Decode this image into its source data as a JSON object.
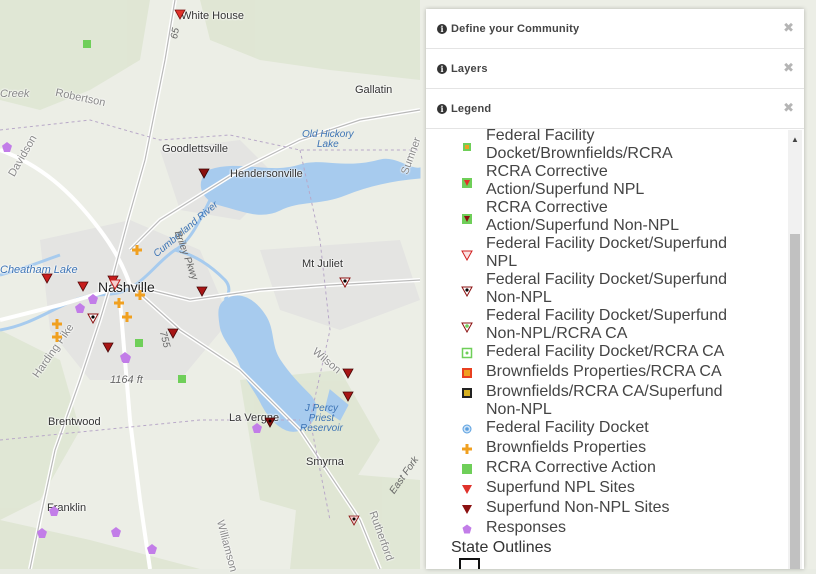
{
  "map": {
    "places": [
      {
        "id": "white-house",
        "label": "White House",
        "big": false
      },
      {
        "id": "gallatin",
        "label": "Gallatin",
        "big": false
      },
      {
        "id": "robertson",
        "label": "Robertson",
        "big": false
      },
      {
        "id": "creek",
        "label": "Creek",
        "big": false
      },
      {
        "id": "davidson",
        "label": "Davidson",
        "big": false
      },
      {
        "id": "goodlettsville",
        "label": "Goodlettsville",
        "big": false
      },
      {
        "id": "hendersonville",
        "label": "Hendersonville",
        "big": false
      },
      {
        "id": "mt-juliet",
        "label": "Mt Juliet",
        "big": false
      },
      {
        "id": "nashville",
        "label": "Nashville",
        "big": true
      },
      {
        "id": "brentwood",
        "label": "Brentwood",
        "big": false
      },
      {
        "id": "la-vergne",
        "label": "La Vergne",
        "big": false
      },
      {
        "id": "smyrna",
        "label": "Smyrna",
        "big": false
      },
      {
        "id": "franklin",
        "label": "Franklin",
        "big": false
      },
      {
        "id": "sumner",
        "label": "Sumner",
        "big": false
      },
      {
        "id": "wilson",
        "label": "Wilson",
        "big": false
      },
      {
        "id": "williamson",
        "label": "Williamson",
        "big": false
      },
      {
        "id": "rutherford",
        "label": "Rutherford",
        "big": false
      },
      {
        "id": "cheatham",
        "label": "Cheatham Lake",
        "big": false
      },
      {
        "id": "harding-pike",
        "label": "Harding Pike",
        "big": false
      },
      {
        "id": "elev",
        "label": "1164 ft",
        "big": false
      }
    ],
    "water_labels": [
      {
        "id": "old-hickory",
        "label": "Old Hickory\nLake"
      },
      {
        "id": "cumberland",
        "label": "Cumberland River"
      },
      {
        "id": "percy-priest",
        "label": "J Percy\nPriest\nReservoir"
      },
      {
        "id": "briley",
        "label": "Briley Pkwy"
      }
    ],
    "roads": [
      {
        "id": "east-fork",
        "label": "East Fork"
      },
      {
        "id": "rd-65",
        "label": "65"
      },
      {
        "id": "rd-755",
        "label": "755"
      }
    ],
    "markers": [
      {
        "type": "superfund-npl"
      },
      {
        "type": "superfund-npl"
      },
      {
        "type": "superfund-npl"
      },
      {
        "type": "superfund-npl"
      },
      {
        "type": "superfund-npl"
      },
      {
        "type": "superfund-npl"
      },
      {
        "type": "superfund-npl"
      },
      {
        "type": "superfund-npl"
      },
      {
        "type": "superfund-npl"
      },
      {
        "type": "superfund-npl"
      },
      {
        "type": "superfund-non-npl"
      },
      {
        "type": "superfund-non-npl"
      },
      {
        "type": "ffd-superfund-non-npl"
      },
      {
        "type": "ffd-superfund-non-npl"
      },
      {
        "type": "ffd-superfund-npl"
      },
      {
        "type": "brownfields"
      },
      {
        "type": "brownfields"
      },
      {
        "type": "brownfields"
      },
      {
        "type": "brownfields"
      },
      {
        "type": "brownfields"
      },
      {
        "type": "rcra-corrective"
      },
      {
        "type": "rcra-corrective"
      },
      {
        "type": "rcra-corrective"
      },
      {
        "type": "response"
      },
      {
        "type": "response"
      },
      {
        "type": "response"
      },
      {
        "type": "response"
      },
      {
        "type": "response"
      },
      {
        "type": "response"
      },
      {
        "type": "response"
      },
      {
        "type": "response"
      },
      {
        "type": "response"
      },
      {
        "type": "response"
      }
    ]
  },
  "panel": {
    "sections": [
      {
        "id": "define",
        "title": "Define your Community",
        "close": "✖"
      },
      {
        "id": "layers",
        "title": "Layers",
        "close": "✖"
      },
      {
        "id": "legend",
        "title": "Legend",
        "close": "✖"
      }
    ],
    "legend_items": [
      {
        "symbol": "rcra-green-sq",
        "label": "Federal Facility\nDocket/Brownfields/RCRA"
      },
      {
        "symbol": "rcra-npl",
        "label": "RCRA Corrective\nAction/Superfund NPL"
      },
      {
        "symbol": "rcra-non-npl",
        "label": "RCRA Corrective\nAction/Superfund Non-NPL"
      },
      {
        "symbol": "ffd-npl",
        "label": "Federal Facility Docket/Superfund\nNPL"
      },
      {
        "symbol": "ffd-non-npl",
        "label": "Federal Facility Docket/Superfund\nNon-NPL"
      },
      {
        "symbol": "ffd-non-npl-rcra",
        "label": "Federal Facility Docket/Superfund\nNon-NPL/RCRA CA"
      },
      {
        "symbol": "ffd-rcra",
        "label": "Federal Facility Docket/RCRA CA"
      },
      {
        "symbol": "brownfields-rcra",
        "label": "Brownfields Properties/RCRA CA"
      },
      {
        "symbol": "brownfields-rcra-non-npl",
        "label": "Brownfields/RCRA CA/Superfund\nNon-NPL"
      },
      {
        "symbol": "ffd",
        "label": "Federal Facility Docket"
      },
      {
        "symbol": "brownfields",
        "label": "Brownfields Properties"
      },
      {
        "symbol": "rcra",
        "label": "RCRA Corrective Action"
      },
      {
        "symbol": "superfund-npl",
        "label": "Superfund NPL Sites"
      },
      {
        "symbol": "superfund-non-npl",
        "label": "Superfund Non-NPL Sites"
      },
      {
        "symbol": "responses",
        "label": "Responses"
      }
    ],
    "state_outlines_title": "State Outlines",
    "scroll_up": "▲"
  },
  "colors": {
    "npl_red": "#e0322b",
    "non_npl_darkred": "#8b1010",
    "brownfield_orange": "#f0a020",
    "rcra_green": "#6fcf59",
    "response_purple": "#c27de8",
    "ffd_blue": "#5aa0e0",
    "water": "#a7cbee"
  }
}
